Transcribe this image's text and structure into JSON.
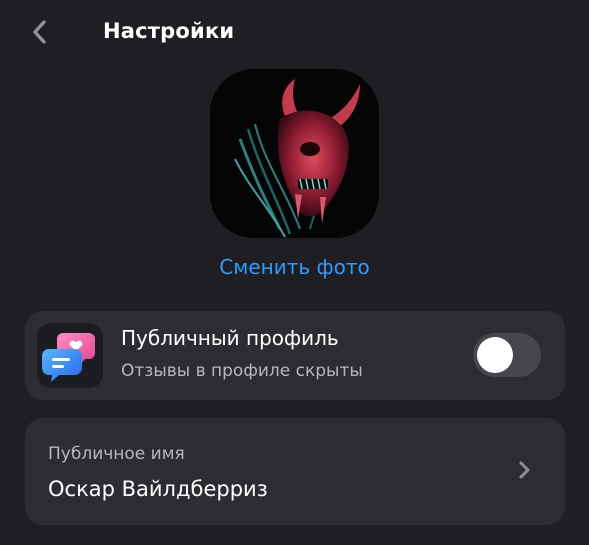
{
  "header": {
    "back_icon": "chevron-left-icon",
    "title": "Настройки"
  },
  "profile_photo": {
    "description_icon": "avatar-image",
    "change_label": "Сменить фото"
  },
  "public_profile": {
    "icon": "chat-bubbles-heart-icon",
    "title": "Публичный профиль",
    "subtitle": "Отзывы в профиле скрыты",
    "toggle_on": false
  },
  "public_name": {
    "label": "Публичное имя",
    "value": "Оскар Вайлдберриз",
    "icon": "chevron-right-icon"
  },
  "colors": {
    "background": "#1f1f23",
    "card": "#2c2d31",
    "accent": "#2f9bff",
    "secondary_text": "#b6b7bc"
  }
}
